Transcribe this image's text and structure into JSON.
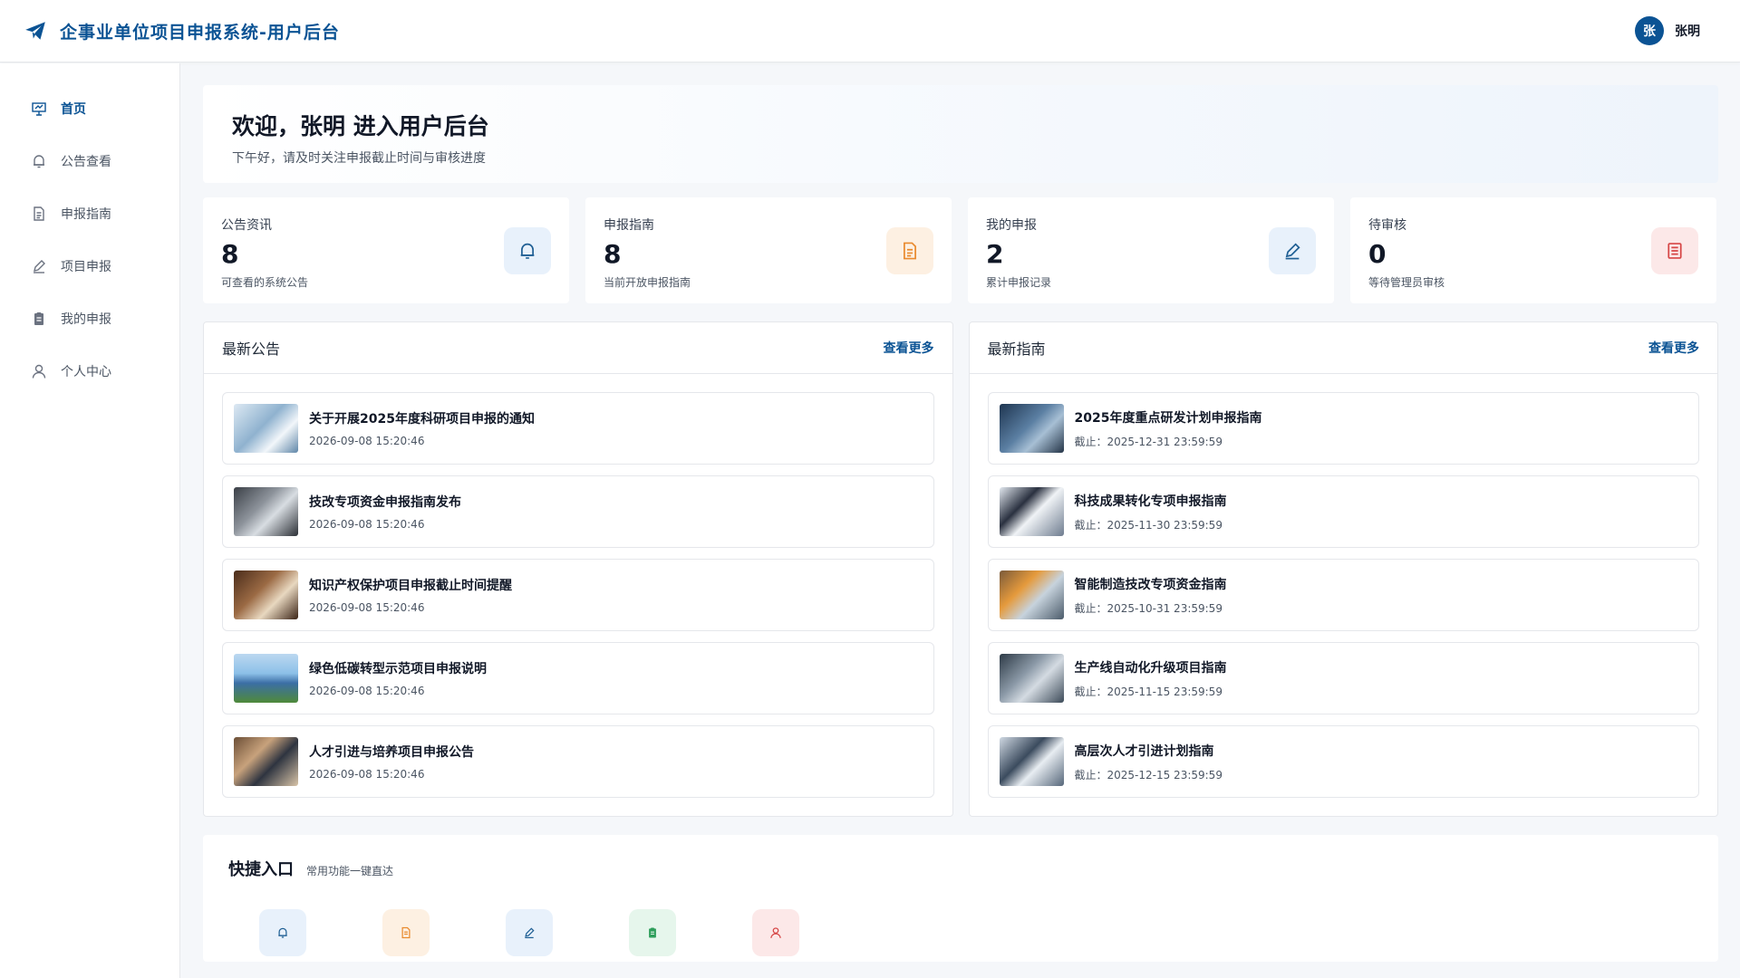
{
  "header": {
    "title": "企事业单位项目申报系统-用户后台",
    "avatar_char": "张",
    "user_name": "张明"
  },
  "sidebar": {
    "items": [
      {
        "label": "首页",
        "icon": "presentation-icon"
      },
      {
        "label": "公告查看",
        "icon": "bell-icon"
      },
      {
        "label": "申报指南",
        "icon": "document-icon"
      },
      {
        "label": "项目申报",
        "icon": "edit-icon"
      },
      {
        "label": "我的申报",
        "icon": "clipboard-icon"
      },
      {
        "label": "个人中心",
        "icon": "user-icon"
      }
    ]
  },
  "welcome": {
    "title": "欢迎，张明 进入用户后台",
    "subtitle": "下午好，请及时关注申报截止时间与审核进度"
  },
  "stats": [
    {
      "label": "公告资讯",
      "value": "8",
      "sub": "可查看的系统公告",
      "icon": "bell-icon",
      "color": "#1f5f94",
      "bg": "#e8f1fb"
    },
    {
      "label": "申报指南",
      "value": "8",
      "sub": "当前开放申报指南",
      "icon": "document-icon",
      "color": "#e98a2e",
      "bg": "#fdf0e2"
    },
    {
      "label": "我的申报",
      "value": "2",
      "sub": "累计申报记录",
      "icon": "edit-icon",
      "color": "#1f5f94",
      "bg": "#e8f1fb"
    },
    {
      "label": "待审核",
      "value": "0",
      "sub": "等待管理员审核",
      "icon": "list-icon",
      "color": "#d64545",
      "bg": "#fce8e8"
    }
  ],
  "announcements": {
    "title": "最新公告",
    "more": "查看更多",
    "items": [
      {
        "title": "关于开展2025年度科研项目申报的通知",
        "date": "2026-09-08 15:20:46"
      },
      {
        "title": "技改专项资金申报指南发布",
        "date": "2026-09-08 15:20:46"
      },
      {
        "title": "知识产权保护项目申报截止时间提醒",
        "date": "2026-09-08 15:20:46"
      },
      {
        "title": "绿色低碳转型示范项目申报说明",
        "date": "2026-09-08 15:20:46"
      },
      {
        "title": "人才引进与培养项目申报公告",
        "date": "2026-09-08 15:20:46"
      }
    ]
  },
  "guides": {
    "title": "最新指南",
    "more": "查看更多",
    "items": [
      {
        "title": "2025年度重点研发计划申报指南",
        "date": "截止：2025-12-31 23:59:59"
      },
      {
        "title": "科技成果转化专项申报指南",
        "date": "截止：2025-11-30 23:59:59"
      },
      {
        "title": "智能制造技改专项资金指南",
        "date": "截止：2025-10-31 23:59:59"
      },
      {
        "title": "生产线自动化升级项目指南",
        "date": "截止：2025-11-15 23:59:59"
      },
      {
        "title": "高层次人才引进计划指南",
        "date": "截止：2025-12-15 23:59:59"
      }
    ]
  },
  "quick": {
    "title": "快捷入口",
    "subtitle": "常用功能一键直达",
    "items": [
      {
        "icon": "bell-icon",
        "color": "#1f5f94",
        "bg": "#e8f1fb"
      },
      {
        "icon": "document-icon",
        "color": "#e98a2e",
        "bg": "#fdf0e2"
      },
      {
        "icon": "edit-icon",
        "color": "#1f5f94",
        "bg": "#e8f1fb"
      },
      {
        "icon": "clipboard-icon",
        "color": "#2e9e5b",
        "bg": "#e6f6ec"
      },
      {
        "icon": "user-icon",
        "color": "#d64545",
        "bg": "#fce8e8"
      }
    ]
  }
}
